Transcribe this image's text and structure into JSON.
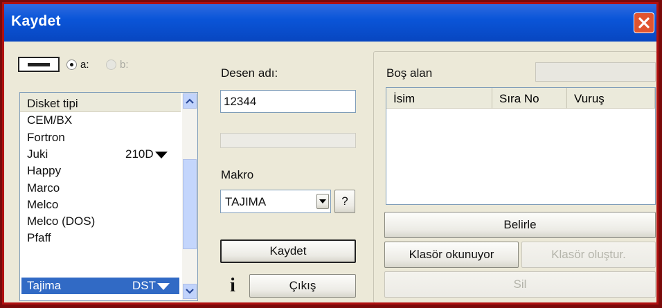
{
  "window": {
    "title": "Kaydet"
  },
  "drives": {
    "a": "a:",
    "b": "b:"
  },
  "disk_list": {
    "header": "Disket tipi",
    "items": [
      {
        "label": "CEM/BX",
        "format": ""
      },
      {
        "label": "Fortron",
        "format": ""
      },
      {
        "label": "Juki",
        "format": "210D"
      },
      {
        "label": "Happy",
        "format": ""
      },
      {
        "label": "Marco",
        "format": ""
      },
      {
        "label": "Melco",
        "format": ""
      },
      {
        "label": "Melco (DOS)",
        "format": ""
      },
      {
        "label": "Pfaff",
        "format": ""
      },
      {
        "label": "Tajima",
        "format": "DST"
      }
    ],
    "selected": "Tajima"
  },
  "design": {
    "label": "Desen adı:",
    "value": "12344"
  },
  "macro": {
    "label": "Makro",
    "value": "TAJIMA",
    "help": "?"
  },
  "buttons": {
    "save": "Kaydet",
    "exit": "Çıkış",
    "info": "i",
    "set": "Belirle",
    "reading_folder": "Klasör okunuyor",
    "create_folder": "Klasör oluştur.",
    "delete": "Sil"
  },
  "free_space": {
    "label": "Boş alan",
    "value": ""
  },
  "file_table": {
    "columns": [
      "İsim",
      "Sıra No",
      "Vuruş"
    ],
    "rows": []
  },
  "colors": {
    "titlebar": "#0a55d8",
    "selection": "#316ac5",
    "frame": "#b01010"
  }
}
